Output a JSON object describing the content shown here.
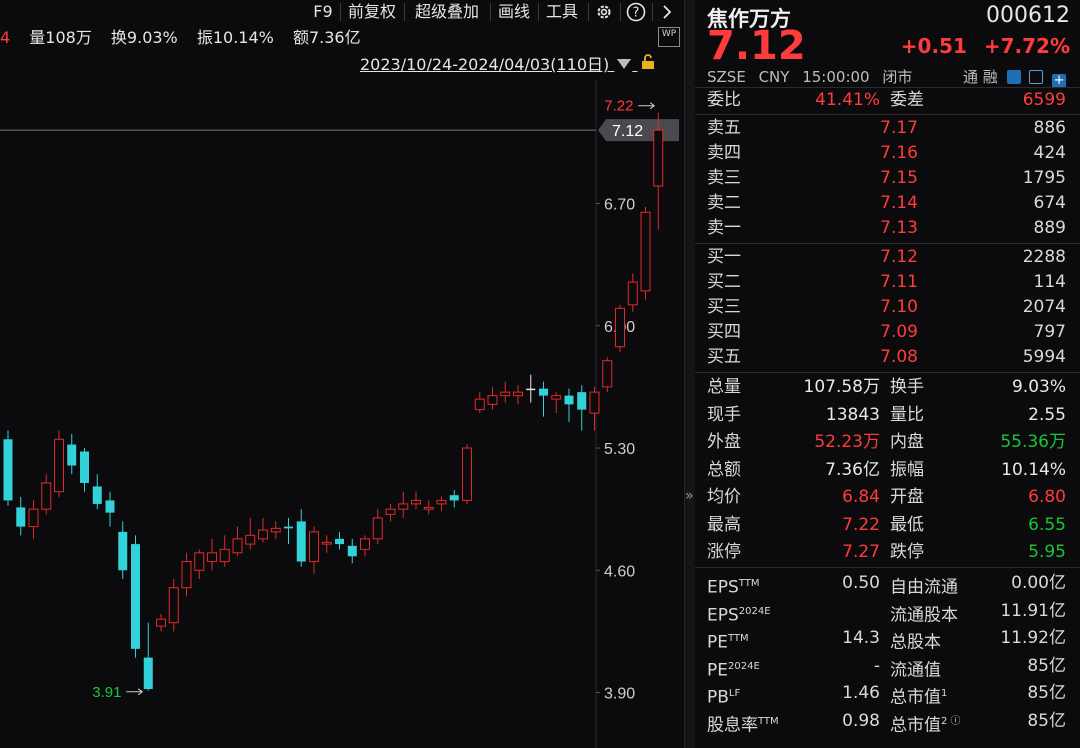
{
  "toolbar": {
    "items": [
      "F9",
      "前复权",
      "超级叠加",
      "画线",
      "工具"
    ],
    "gear_icon": "gear-icon",
    "help_icon": "question-circle-icon",
    "next_icon": "chevron-right-icon"
  },
  "stats": {
    "lead": "4",
    "volume": "量108万",
    "turnover": "换9.03%",
    "amplitude": "振10.14%",
    "amount": "额7.36亿",
    "wp_badge": "WP"
  },
  "range": {
    "label": "2023/10/24-2024/04/03(110日)"
  },
  "chart_data": {
    "type": "candlestick",
    "y_ticks": [
      "6.70",
      "6.00",
      "5.30",
      "4.60",
      "3.90"
    ],
    "ylim": [
      3.8,
      7.35
    ],
    "current_price_label": "7.12",
    "high_marker": "7.22",
    "low_marker": "3.91",
    "up_color": "#e02a2a",
    "down_color": "#32d2d8",
    "candles": [
      [
        5.35,
        5.0,
        5.4,
        4.97
      ],
      [
        4.96,
        4.85,
        5.02,
        4.8
      ],
      [
        4.85,
        4.95,
        5.0,
        4.78
      ],
      [
        4.95,
        5.1,
        5.15,
        4.92
      ],
      [
        5.05,
        5.35,
        5.4,
        5.02
      ],
      [
        5.32,
        5.2,
        5.38,
        5.15
      ],
      [
        5.28,
        5.1,
        5.3,
        5.05
      ],
      [
        5.08,
        4.98,
        5.15,
        4.95
      ],
      [
        5.0,
        4.93,
        5.05,
        4.85
      ],
      [
        4.82,
        4.6,
        4.88,
        4.55
      ],
      [
        4.75,
        4.15,
        4.8,
        4.1
      ],
      [
        4.1,
        3.92,
        4.3,
        3.91
      ],
      [
        4.28,
        4.32,
        4.35,
        4.25
      ],
      [
        4.3,
        4.5,
        4.55,
        4.25
      ],
      [
        4.5,
        4.65,
        4.7,
        4.45
      ],
      [
        4.6,
        4.7,
        4.72,
        4.55
      ],
      [
        4.65,
        4.7,
        4.78,
        4.6
      ],
      [
        4.65,
        4.72,
        4.8,
        4.62
      ],
      [
        4.7,
        4.78,
        4.85,
        4.68
      ],
      [
        4.75,
        4.8,
        4.9,
        4.72
      ],
      [
        4.78,
        4.83,
        4.9,
        4.76
      ],
      [
        4.82,
        4.84,
        4.88,
        4.78
      ],
      [
        4.85,
        4.84,
        4.9,
        4.75
      ],
      [
        4.88,
        4.65,
        4.95,
        4.62
      ],
      [
        4.65,
        4.82,
        4.85,
        4.58
      ],
      [
        4.75,
        4.76,
        4.8,
        4.7
      ],
      [
        4.78,
        4.75,
        4.82,
        4.72
      ],
      [
        4.74,
        4.68,
        4.78,
        4.64
      ],
      [
        4.72,
        4.78,
        4.8,
        4.68
      ],
      [
        4.78,
        4.9,
        4.95,
        4.75
      ],
      [
        4.92,
        4.95,
        4.98,
        4.88
      ],
      [
        4.95,
        4.98,
        5.05,
        4.9
      ],
      [
        4.98,
        5.0,
        5.05,
        4.95
      ],
      [
        4.95,
        4.96,
        5.0,
        4.92
      ],
      [
        4.98,
        5.0,
        5.02,
        4.94
      ],
      [
        5.03,
        5.0,
        5.06,
        4.96
      ],
      [
        5.0,
        5.3,
        5.32,
        4.98
      ],
      [
        5.52,
        5.58,
        5.62,
        5.5
      ],
      [
        5.55,
        5.6,
        5.65,
        5.52
      ],
      [
        5.6,
        5.62,
        5.68,
        5.56
      ],
      [
        5.6,
        5.62,
        5.66,
        5.55
      ],
      [
        5.64,
        5.64,
        5.72,
        5.56
      ],
      [
        5.64,
        5.6,
        5.68,
        5.48
      ],
      [
        5.58,
        5.6,
        5.62,
        5.5
      ],
      [
        5.6,
        5.55,
        5.64,
        5.45
      ],
      [
        5.62,
        5.52,
        5.66,
        5.4
      ],
      [
        5.5,
        5.62,
        5.65,
        5.4
      ],
      [
        5.65,
        5.8,
        5.82,
        5.62
      ],
      [
        5.88,
        6.1,
        6.12,
        5.85
      ],
      [
        6.12,
        6.25,
        6.3,
        6.08
      ],
      [
        6.2,
        6.65,
        6.68,
        6.15
      ],
      [
        6.8,
        7.12,
        7.22,
        6.55
      ]
    ]
  },
  "quote": {
    "name": "焦作万方",
    "code": "000612",
    "price": "7.12",
    "change": "+0.51",
    "change_pct": "+7.72%",
    "exchange": "SZSE",
    "currency": "CNY",
    "time": "15:00:00",
    "status": "闭市",
    "tags": "通 融"
  },
  "order_book": {
    "ratio_label": "委比",
    "ratio_value": "41.41%",
    "diff_label": "委差",
    "diff_value": "6599",
    "asks": [
      {
        "label": "卖五",
        "price": "7.17",
        "vol": "886"
      },
      {
        "label": "卖四",
        "price": "7.16",
        "vol": "424"
      },
      {
        "label": "卖三",
        "price": "7.15",
        "vol": "1795"
      },
      {
        "label": "卖二",
        "price": "7.14",
        "vol": "674"
      },
      {
        "label": "卖一",
        "price": "7.13",
        "vol": "889"
      }
    ],
    "bids": [
      {
        "label": "买一",
        "price": "7.12",
        "vol": "2288"
      },
      {
        "label": "买二",
        "price": "7.11",
        "vol": "114"
      },
      {
        "label": "买三",
        "price": "7.10",
        "vol": "2074"
      },
      {
        "label": "买四",
        "price": "7.09",
        "vol": "797"
      },
      {
        "label": "买五",
        "price": "7.08",
        "vol": "5994"
      }
    ]
  },
  "stats_table": [
    {
      "l1": "总量",
      "v1": "107.58万",
      "c1": "white",
      "l2": "换手",
      "v2": "9.03%",
      "c2": "white"
    },
    {
      "l1": "现手",
      "v1": "13843",
      "c1": "white",
      "l2": "量比",
      "v2": "2.55",
      "c2": "white"
    },
    {
      "l1": "外盘",
      "v1": "52.23万",
      "c1": "red",
      "l2": "内盘",
      "v2": "55.36万",
      "c2": "green"
    },
    {
      "l1": "总额",
      "v1": "7.36亿",
      "c1": "white",
      "l2": "振幅",
      "v2": "10.14%",
      "c2": "white"
    },
    {
      "l1": "均价",
      "v1": "6.84",
      "c1": "red",
      "l2": "开盘",
      "v2": "6.80",
      "c2": "red"
    },
    {
      "l1": "最高",
      "v1": "7.22",
      "c1": "red",
      "l2": "最低",
      "v2": "6.55",
      "c2": "green"
    },
    {
      "l1": "涨停",
      "v1": "7.27",
      "c1": "red",
      "l2": "跌停",
      "v2": "5.95",
      "c2": "green"
    }
  ],
  "fundamentals": [
    {
      "l1": "EPS",
      "s1": "TTM",
      "v1": "0.50",
      "l2": "自由流通",
      "s2": "",
      "v2": "0.00亿"
    },
    {
      "l1": "EPS",
      "s1": "2024E",
      "v1": "",
      "l2": "流通股本",
      "s2": "",
      "v2": "11.91亿"
    },
    {
      "l1": "PE",
      "s1": "TTM",
      "v1": "14.3",
      "l2": "总股本",
      "s2": "",
      "v2": "11.92亿"
    },
    {
      "l1": "PE",
      "s1": "2024E",
      "v1": "-",
      "l2": "流通值",
      "s2": "",
      "v2": "85亿"
    },
    {
      "l1": "PB",
      "s1": "LF",
      "v1": "1.46",
      "l2": "总市值",
      "s2": "1",
      "v2": "85亿"
    },
    {
      "l1": "股息率",
      "s1": "TTM",
      "v1": "0.98",
      "l2": "总市值",
      "s2": "2 ⓘ",
      "v2": "85亿"
    }
  ]
}
